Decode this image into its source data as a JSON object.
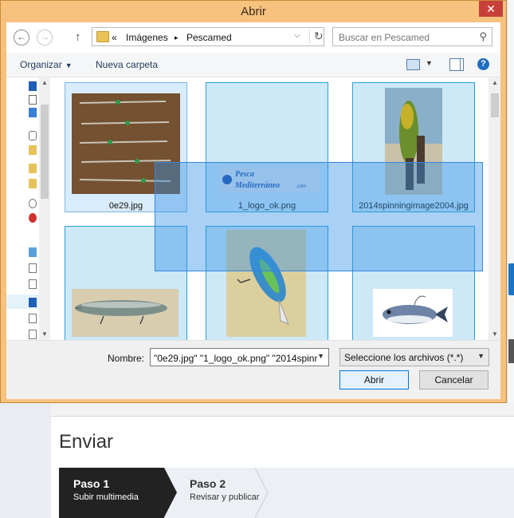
{
  "dialog": {
    "title": "Abrir",
    "close_glyph": "✕",
    "address": {
      "crumbs": [
        "«",
        "Imágenes",
        "▸",
        "Pescamed"
      ]
    },
    "search": {
      "placeholder": "Buscar en Pescamed"
    },
    "toolbar": {
      "organize_label": "Organizar",
      "new_folder_label": "Nueva carpeta",
      "help_glyph": "?"
    },
    "files": [
      {
        "name": "0e29.jpg",
        "selected": true
      },
      {
        "name": "1_logo_ok.png",
        "selected": true
      },
      {
        "name": "2014spinningimage2004.jpg",
        "selected": true
      },
      {
        "name": "",
        "selected": false
      },
      {
        "name": "",
        "selected": false
      },
      {
        "name": "",
        "selected": false
      }
    ],
    "logo_text": {
      "line1": "Pesca",
      "line2": "Mediterráneo",
      "suffix": ".com"
    },
    "filename": {
      "label": "Nombre:",
      "value": "\"0e29.jpg\" \"1_logo_ok.png\" \"2014spinni"
    },
    "filter": {
      "value": "Seleccione los archivos (*.*)"
    },
    "buttons": {
      "open": "Abrir",
      "cancel": "Cancelar"
    }
  },
  "page": {
    "title": "Enviar",
    "steps": [
      {
        "title": "Paso 1",
        "subtitle": "Subir multimedia",
        "active": true
      },
      {
        "title": "Paso 2",
        "subtitle": "Revisar y publicar",
        "active": false
      }
    ]
  },
  "colors": {
    "dialog_frame": "#f6c27e",
    "selection_fill": "#cde8f7",
    "selection_border": "#26a0da",
    "step_active": "#222222"
  }
}
